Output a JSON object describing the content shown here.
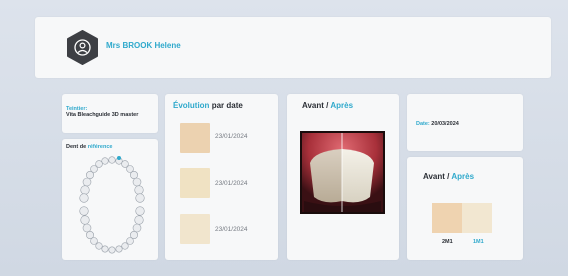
{
  "patient": {
    "name": "Mrs BROOK Helene",
    "avatar_icon": "user-hexagon-icon"
  },
  "teintier": {
    "label": "Teintier:",
    "value": "Vita Bleachguide 3D master"
  },
  "dent_ref": {
    "label_plain": "Dent de",
    "label_accent": "référence"
  },
  "evolution": {
    "title_accent": "Évolution",
    "title_plain": "par date",
    "entries": [
      {
        "date": "23/01/2024",
        "color": "#ecd2b0"
      },
      {
        "date": "23/01/2024",
        "color": "#f0e2c3"
      },
      {
        "date": "23/01/2024",
        "color": "#f1e5cd"
      }
    ]
  },
  "avant_apres_photo": {
    "avant": "Avant",
    "sep": "/",
    "apres": "Après"
  },
  "date_panel": {
    "label": "Date:",
    "value": "20/03/2024"
  },
  "comparison": {
    "avant": "Avant",
    "sep": "/",
    "apres": "Après",
    "shades": [
      {
        "code": "2M1",
        "color": "#efd3b0"
      },
      {
        "code": "1M1",
        "color": "#f2e7d1"
      }
    ]
  },
  "colors": {
    "accent": "#2fa9cc",
    "avatar_bg": "#3d3f44"
  }
}
